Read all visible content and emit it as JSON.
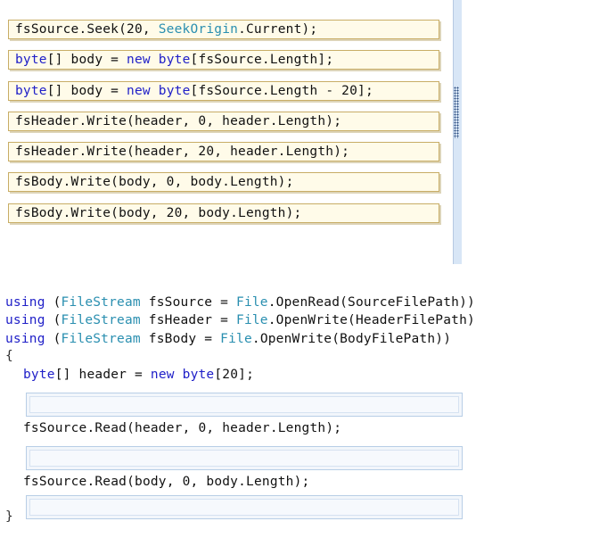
{
  "tiles": [
    {
      "parts": [
        {
          "t": "fsSource.Seek(20, ",
          "c": "plain"
        },
        {
          "t": "SeekOrigin",
          "c": "type"
        },
        {
          "t": ".Current);",
          "c": "plain"
        }
      ]
    },
    {
      "parts": [
        {
          "t": "byte",
          "c": "kw"
        },
        {
          "t": "[] body = ",
          "c": "plain"
        },
        {
          "t": "new",
          "c": "kw"
        },
        {
          "t": " ",
          "c": "plain"
        },
        {
          "t": "byte",
          "c": "kw"
        },
        {
          "t": "[fsSource.Length];",
          "c": "plain"
        }
      ]
    },
    {
      "parts": [
        {
          "t": "byte",
          "c": "kw"
        },
        {
          "t": "[] body = ",
          "c": "plain"
        },
        {
          "t": "new",
          "c": "kw"
        },
        {
          "t": " ",
          "c": "plain"
        },
        {
          "t": "byte",
          "c": "kw"
        },
        {
          "t": "[fsSource.Length - 20];",
          "c": "plain"
        }
      ]
    },
    {
      "parts": [
        {
          "t": "fsHeader.Write(header, 0, header.Length);",
          "c": "plain"
        }
      ]
    },
    {
      "parts": [
        {
          "t": "fsHeader.Write(header, 20, header.Length);",
          "c": "plain"
        }
      ]
    },
    {
      "parts": [
        {
          "t": "fsBody.Write(body, 0, body.Length);",
          "c": "plain"
        }
      ]
    },
    {
      "parts": [
        {
          "t": "fsBody.Write(body, 20, body.Length);",
          "c": "plain"
        }
      ]
    }
  ],
  "code": {
    "using1": {
      "kw": "using",
      "a": " (",
      "type": "FileStream",
      "b": " fsSource = ",
      "type2": "File",
      "c": ".OpenRead(SourceFilePath))"
    },
    "using2": {
      "kw": "using",
      "a": " (",
      "type": "FileStream",
      "b": " fsHeader = ",
      "type2": "File",
      "c": ".OpenWrite(HeaderFilePath)"
    },
    "using3": {
      "kw": "using",
      "a": " (",
      "type": "FileStream",
      "b": " fsBody = ",
      "type2": "File",
      "c": ".OpenWrite(BodyFilePath))"
    },
    "open_brace": "{",
    "header_decl": {
      "kw1": "byte",
      "a": "[] header = ",
      "kw2": "new",
      "kw3": "byte",
      "b": "[20];"
    },
    "read_header": "fsSource.Read(header, 0, header.Length);",
    "read_body": "fsSource.Read(body, 0, body.Length);",
    "close_brace": "}"
  }
}
